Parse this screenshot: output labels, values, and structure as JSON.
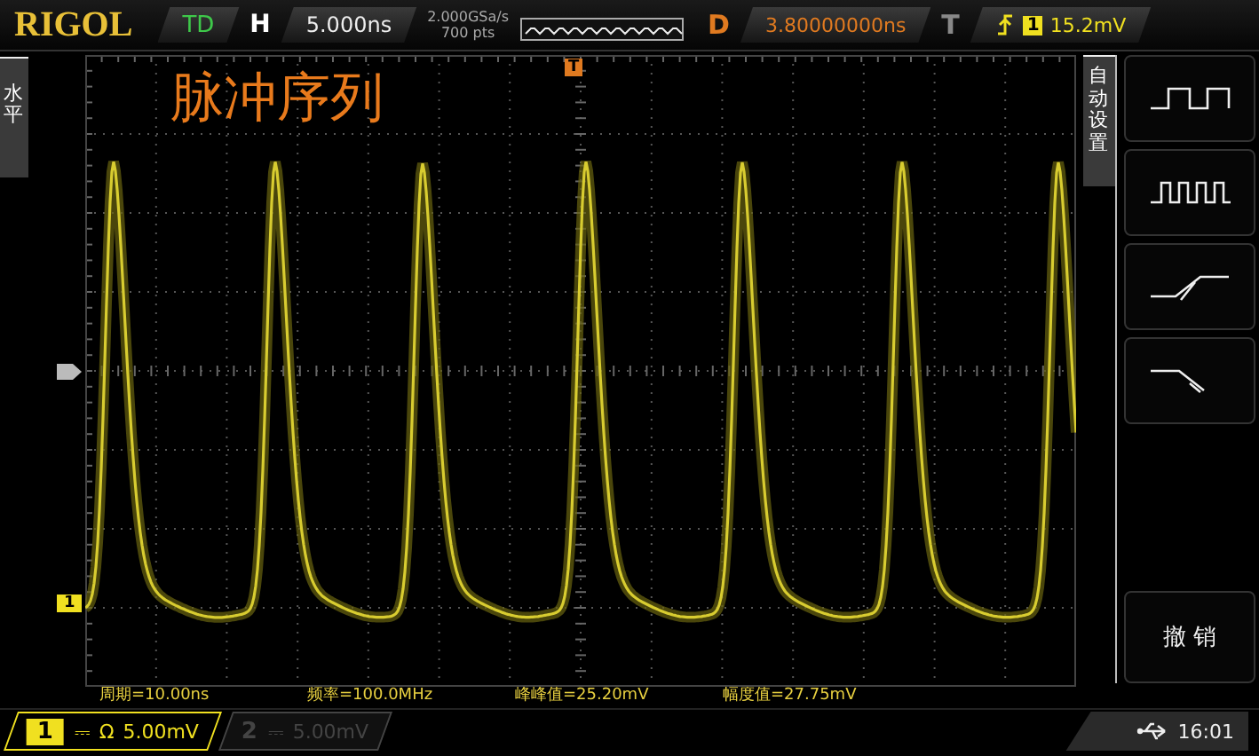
{
  "brand": "RIGOL",
  "run_state": "TD",
  "horizontal": {
    "label": "H",
    "timebase": "5.000ns",
    "sample_rate": "2.000GSa/s",
    "memory_depth": "700 pts"
  },
  "delay": {
    "label": "D",
    "value": "3.80000000ns"
  },
  "trigger": {
    "label": "T",
    "kind": "rising_edge",
    "source": "1",
    "level": "15.2mV",
    "position_marker": "T"
  },
  "left_tab": {
    "label": "水平"
  },
  "title": "脉冲序列",
  "channel_marker": {
    "label": "1"
  },
  "measurements": [
    "周期=10.00ns",
    "频率=100.0MHz",
    "峰峰值=25.20mV",
    "幅度值=27.75mV"
  ],
  "menu": {
    "title": "自动设置",
    "items": [
      {
        "kind": "single_cycle"
      },
      {
        "kind": "multi_cycle"
      },
      {
        "kind": "rise_time"
      },
      {
        "kind": "fall_time"
      },
      {
        "kind": "blank"
      },
      {
        "kind": "text",
        "label": "撤 销"
      }
    ]
  },
  "channels": [
    {
      "number": "1",
      "coupling": "⎓",
      "impedance": "Ω",
      "scale": "5.00mV",
      "on": true
    },
    {
      "number": "2",
      "coupling": "⎓",
      "scale": "5.00mV",
      "on": false
    }
  ],
  "clock": "16:01"
}
